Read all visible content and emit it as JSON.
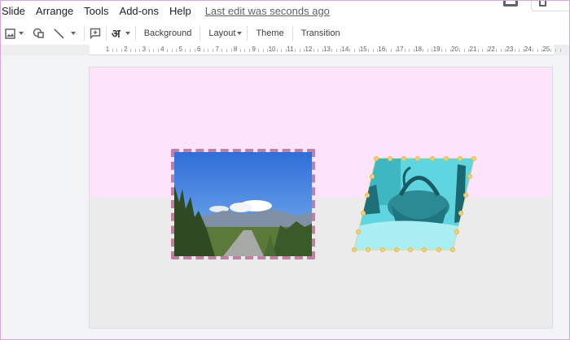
{
  "menu": {
    "items": [
      "Slide",
      "Arrange",
      "Tools",
      "Add-ons",
      "Help"
    ],
    "last_edit": "Last edit was seconds ago"
  },
  "toolbar": {
    "background_label": "Background",
    "layout_label": "Layout",
    "theme_label": "Theme",
    "transition_label": "Transition",
    "input_tools_glyph": "अ"
  },
  "ruler": {
    "numbers": [
      "1",
      "2",
      "3",
      "4",
      "5",
      "6",
      "7",
      "8",
      "9",
      "10",
      "11",
      "12",
      "13",
      "14",
      "15",
      "16",
      "17",
      "18",
      "19",
      "20",
      "21",
      "22",
      "23",
      "24",
      "25"
    ]
  },
  "colors": {
    "slide_top": "#fde4fb",
    "slide_bottom": "#ebebeb",
    "image1_border": "#c07fa5",
    "image2_border_dots": "#f0d27a",
    "image2_tint": "#5fd6df"
  }
}
